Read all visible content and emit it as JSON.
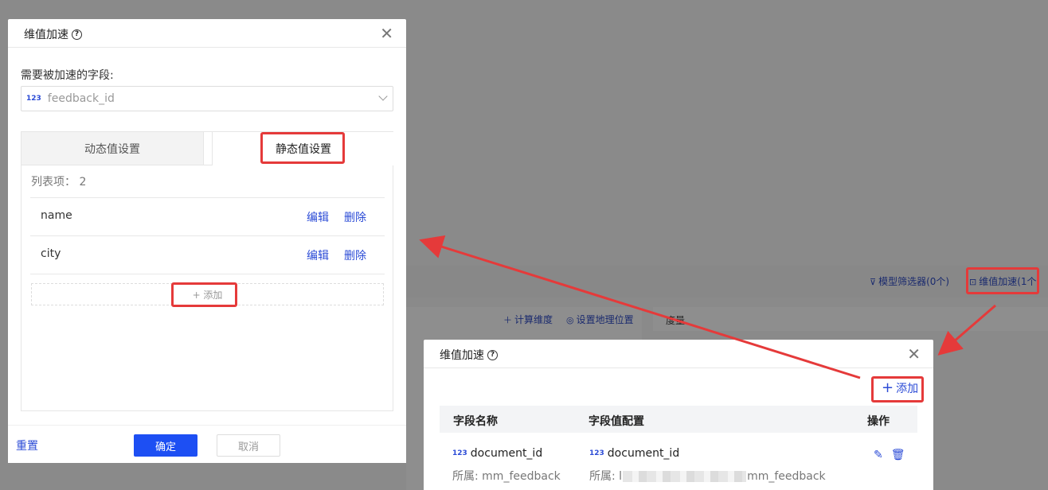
{
  "background": {
    "toolbar": {
      "model_filter": "模型筛选器(0个)",
      "dim_accel": "维值加速(1个"
    },
    "fields_toolbar": {
      "calc_dim": "计算维度",
      "set_geo": "设置地理位置"
    },
    "metrics_label": "度量"
  },
  "dialog_edit": {
    "title": "维值加速",
    "field_label": "需要被加速的字段:",
    "field_type_icon": "123",
    "field_value": "feedback_id",
    "tabs": {
      "dynamic": "动态值设置",
      "static": "静态值设置"
    },
    "list_count_label": "列表项：",
    "list_count": "2",
    "items": [
      {
        "name": "name",
        "edit": "编辑",
        "delete": "删除"
      },
      {
        "name": "city",
        "edit": "编辑",
        "delete": "删除"
      }
    ],
    "add_label": "+ 添加",
    "footer": {
      "reset": "重置",
      "confirm": "确定",
      "cancel": "取消"
    }
  },
  "dialog_list": {
    "title": "维值加速",
    "add_label": "添加",
    "columns": [
      "字段名称",
      "字段值配置",
      "操作"
    ],
    "rows": [
      {
        "type_icon": "123",
        "field_name": "document_id",
        "belongs_prefix": "所属:",
        "field_owner": "mm_feedback",
        "value_type_icon": "123",
        "value_field": "document_id",
        "value_owner_start": "l",
        "value_owner_end": "mm_feedback"
      }
    ]
  },
  "annotation_color": "#e53a3a"
}
